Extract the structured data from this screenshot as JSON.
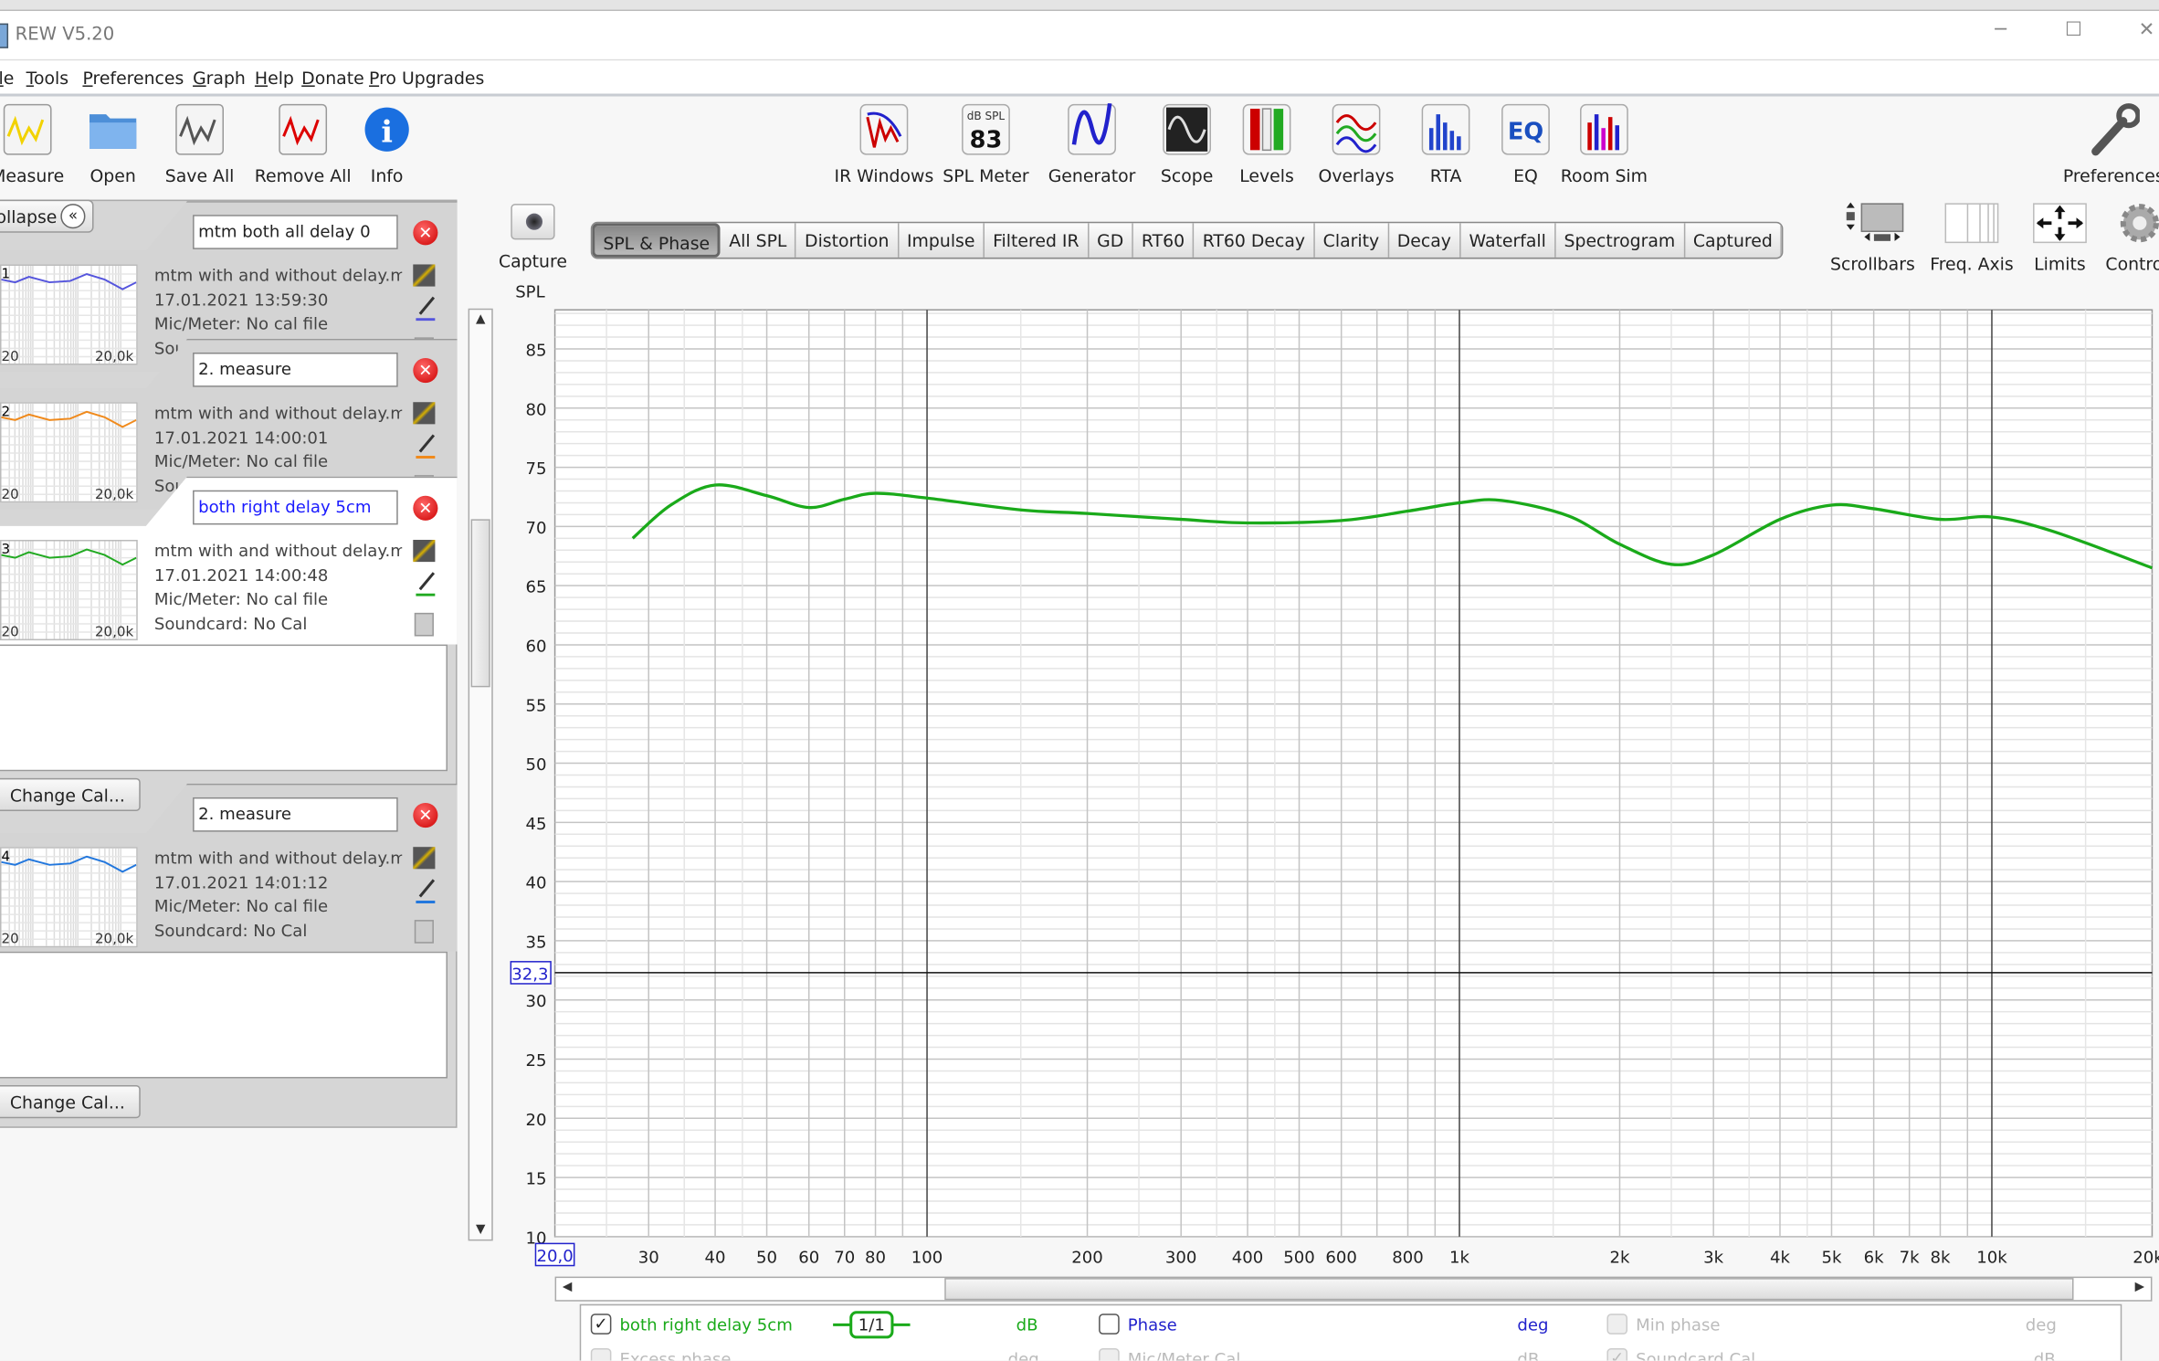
{
  "window": {
    "title": "REW V5.20",
    "controls": [
      "minimize",
      "maximize",
      "close"
    ]
  },
  "menu": [
    "le",
    "Tools",
    "Preferences",
    "Graph",
    "Help",
    "Donate",
    "Pro Upgrades"
  ],
  "toolbar_left": [
    {
      "label": "Measure",
      "icon": "measure-icon"
    },
    {
      "label": "Open",
      "icon": "folder-icon"
    },
    {
      "label": "Save All",
      "icon": "save-all-icon"
    },
    {
      "label": "Remove All",
      "icon": "remove-all-icon"
    },
    {
      "label": "Info",
      "icon": "info-icon"
    }
  ],
  "toolbar_center": [
    {
      "label": "IR Windows",
      "icon": "ir-windows-icon"
    },
    {
      "label": "SPL Meter",
      "icon": "spl-meter-icon",
      "badge_top": "dB SPL",
      "badge_value": "83"
    },
    {
      "label": "Generator",
      "icon": "generator-icon"
    },
    {
      "label": "Scope",
      "icon": "scope-icon"
    },
    {
      "label": "Levels",
      "icon": "levels-icon"
    },
    {
      "label": "Overlays",
      "icon": "overlays-icon"
    },
    {
      "label": "RTA",
      "icon": "rta-icon"
    },
    {
      "label": "EQ",
      "icon": "eq-icon"
    },
    {
      "label": "Room Sim",
      "icon": "room-sim-icon"
    }
  ],
  "toolbar_right": {
    "label": "Preferences",
    "icon": "wrench-icon"
  },
  "left_panel": {
    "collapse_label": "ollapse",
    "measurements": [
      {
        "name": "mtm both all delay 0",
        "file": "mtm with and without delay.mdat",
        "date": "17.01.2021 13:59:30",
        "mic": "Mic/Meter: No cal file",
        "soundcard": "Soundcard: No Cal",
        "index": "1",
        "color": "#5555dd",
        "selected": false,
        "thumb_min": "20",
        "thumb_max": "20,0k"
      },
      {
        "name": "2. measure",
        "file": "mtm with and without delay.mdat",
        "date": "17.01.2021 14:00:01",
        "mic": "Mic/Meter: No cal file",
        "soundcard": "Soundcard: No Cal",
        "index": "2",
        "color": "#f08a1c",
        "selected": false,
        "thumb_min": "20",
        "thumb_max": "20,0k"
      },
      {
        "name": "both right delay 5cm",
        "file": "mtm with and without delay.mdat",
        "date": "17.01.2021 14:00:48",
        "mic": "Mic/Meter: No cal file",
        "soundcard": "Soundcard: No Cal",
        "index": "3",
        "color": "#22aa22",
        "selected": true,
        "thumb_min": "20",
        "thumb_max": "20,0k"
      },
      {
        "name": "2. measure",
        "file": "mtm with and without delay.mdat",
        "date": "17.01.2021 14:01:12",
        "mic": "Mic/Meter: No cal file",
        "soundcard": "Soundcard: No Cal",
        "index": "4",
        "color": "#2277dd",
        "selected": false,
        "thumb_min": "20",
        "thumb_max": "20,0k"
      }
    ],
    "change_cal_label": "Change Cal..."
  },
  "capture": {
    "label": "Capture"
  },
  "tabs": [
    {
      "label": "SPL & Phase",
      "active": true
    },
    {
      "label": "All SPL"
    },
    {
      "label": "Distortion"
    },
    {
      "label": "Impulse"
    },
    {
      "label": "Filtered IR"
    },
    {
      "label": "GD"
    },
    {
      "label": "RT60"
    },
    {
      "label": "RT60 Decay"
    },
    {
      "label": "Clarity"
    },
    {
      "label": "Decay"
    },
    {
      "label": "Waterfall"
    },
    {
      "label": "Spectrogram"
    },
    {
      "label": "Captured"
    }
  ],
  "graph_controls": [
    {
      "label": "Scrollbars",
      "icon": "scrollbars-icon"
    },
    {
      "label": "Freq. Axis",
      "icon": "freq-axis-icon"
    },
    {
      "label": "Limits",
      "icon": "limits-icon"
    },
    {
      "label": "Contro",
      "icon": "gear-icon"
    }
  ],
  "chart_data": {
    "type": "line",
    "ylabel": "SPL",
    "xscale": "log",
    "xlim": [
      20,
      20000
    ],
    "ylim": [
      10,
      88.3
    ],
    "grid": true,
    "yticks": [
      10,
      15,
      20,
      25,
      30,
      35,
      40,
      45,
      50,
      55,
      60,
      65,
      70,
      75,
      80,
      85
    ],
    "xticks": [
      {
        "v": 30,
        "l": "30"
      },
      {
        "v": 40,
        "l": "40"
      },
      {
        "v": 50,
        "l": "50"
      },
      {
        "v": 60,
        "l": "60"
      },
      {
        "v": 70,
        "l": "70"
      },
      {
        "v": 80,
        "l": "80"
      },
      {
        "v": 100,
        "l": "100"
      },
      {
        "v": 200,
        "l": "200"
      },
      {
        "v": 300,
        "l": "300"
      },
      {
        "v": 400,
        "l": "400"
      },
      {
        "v": 500,
        "l": "500"
      },
      {
        "v": 600,
        "l": "600"
      },
      {
        "v": 800,
        "l": "800"
      },
      {
        "v": 1000,
        "l": "1k"
      },
      {
        "v": 2000,
        "l": "2k"
      },
      {
        "v": 3000,
        "l": "3k"
      },
      {
        "v": 4000,
        "l": "4k"
      },
      {
        "v": 5000,
        "l": "5k"
      },
      {
        "v": 6000,
        "l": "6k"
      },
      {
        "v": 7000,
        "l": "7k"
      },
      {
        "v": 8000,
        "l": "8k"
      },
      {
        "v": 10000,
        "l": "10k"
      },
      {
        "v": 20000,
        "l": "20k"
      }
    ],
    "cursor": {
      "y": 32.3,
      "y_label": "32,3",
      "x_label": "20,0"
    },
    "series": [
      {
        "name": "both right delay 5cm",
        "color": "#1aaa1a",
        "x": [
          28,
          33,
          40,
          50,
          60,
          70,
          80,
          100,
          150,
          200,
          300,
          400,
          600,
          800,
          1000,
          1200,
          1600,
          2000,
          2500,
          3000,
          4000,
          5000,
          6000,
          8000,
          10000,
          13000,
          20000
        ],
        "y": [
          69.0,
          71.8,
          73.5,
          72.6,
          71.6,
          72.3,
          72.8,
          72.4,
          71.4,
          71.1,
          70.6,
          70.3,
          70.5,
          71.3,
          72.0,
          72.2,
          70.9,
          68.5,
          66.8,
          67.6,
          70.6,
          71.8,
          71.5,
          70.6,
          70.8,
          69.6,
          66.5
        ]
      }
    ]
  },
  "legend": {
    "row1": [
      {
        "kind": "check",
        "checked": true,
        "label": "both right delay 5cm",
        "color": "#1aaa1a"
      },
      {
        "kind": "smoothing",
        "label": "1/1"
      },
      {
        "kind": "unit",
        "label": "dB",
        "color": "#1aaa1a"
      },
      {
        "kind": "check",
        "checked": false,
        "label": "Phase",
        "color": "#2222cc"
      },
      {
        "kind": "unit",
        "label": "deg",
        "color": "#2222cc"
      },
      {
        "kind": "check",
        "checked": false,
        "disabled": true,
        "label": "Min phase"
      },
      {
        "kind": "unit",
        "label": "deg",
        "disabled": true
      }
    ],
    "row2": [
      {
        "label": "Excess phase",
        "unit": "deg",
        "checked": false
      },
      {
        "label": "Mic/Meter Cal",
        "unit": "dB",
        "checked": false
      },
      {
        "label": "Soundcard Cal",
        "unit": "dB",
        "checked": true
      }
    ]
  }
}
